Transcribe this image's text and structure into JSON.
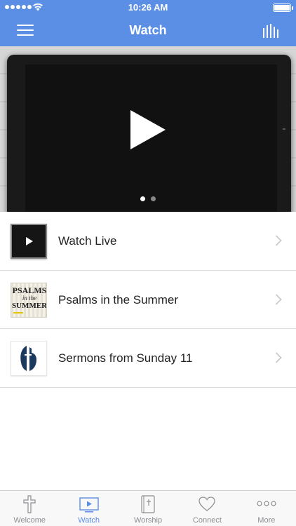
{
  "status_bar": {
    "time": "10:26 AM"
  },
  "nav": {
    "title": "Watch"
  },
  "hero": {
    "pages": 2,
    "active_page": 1
  },
  "list": {
    "items": [
      {
        "label": "Watch Live",
        "thumb": "live-video-thumbnail"
      },
      {
        "label": "Psalms in the Summer",
        "thumb": "psalms-artwork"
      },
      {
        "label": "Sermons from Sunday 11",
        "thumb": "church-logo"
      }
    ]
  },
  "psalms_art": {
    "line1": "PSALMS",
    "line2": "in the",
    "line3": "SUMMER"
  },
  "tabs": [
    {
      "label": "Welcome",
      "icon": "cross-icon",
      "active": false
    },
    {
      "label": "Watch",
      "icon": "video-icon",
      "active": true
    },
    {
      "label": "Worship",
      "icon": "bible-icon",
      "active": false
    },
    {
      "label": "Connect",
      "icon": "heart-icon",
      "active": false
    },
    {
      "label": "More",
      "icon": "more-dots-icon",
      "active": false
    }
  ],
  "colors": {
    "accent": "#5b8fe6",
    "tab_inactive": "#8e8e93",
    "divider": "#dcdcdc"
  }
}
